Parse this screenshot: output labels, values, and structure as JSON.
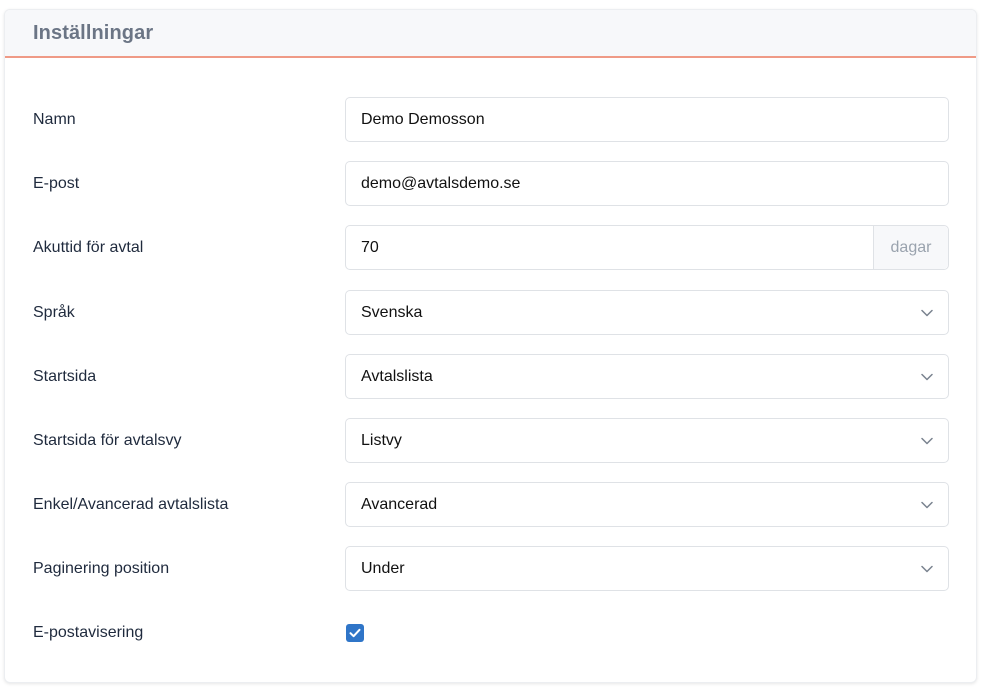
{
  "header": {
    "title": "Inställningar"
  },
  "fields": {
    "name": {
      "label": "Namn",
      "value": "Demo Demosson"
    },
    "email": {
      "label": "E-post",
      "value": "demo@avtalsdemo.se"
    },
    "urgent": {
      "label": "Akuttid för avtal",
      "value": "70",
      "suffix": "dagar"
    },
    "language": {
      "label": "Språk",
      "value": "Svenska"
    },
    "startpage": {
      "label": "Startsida",
      "value": "Avtalslista"
    },
    "agreement_view": {
      "label": "Startsida för avtalsvy",
      "value": "Listvy"
    },
    "list_mode": {
      "label": "Enkel/Avancerad avtalslista",
      "value": "Avancerad"
    },
    "pagination": {
      "label": "Paginering position",
      "value": "Under"
    },
    "email_notice": {
      "label": "E-postavisering",
      "checked": true
    }
  },
  "colors": {
    "accent_line": "#ef9a86",
    "checkbox": "#2f75c8",
    "title": "#6b7585"
  },
  "icons": {
    "select_arrow": "chevron-down-icon",
    "checkbox_mark": "checkmark-icon"
  }
}
